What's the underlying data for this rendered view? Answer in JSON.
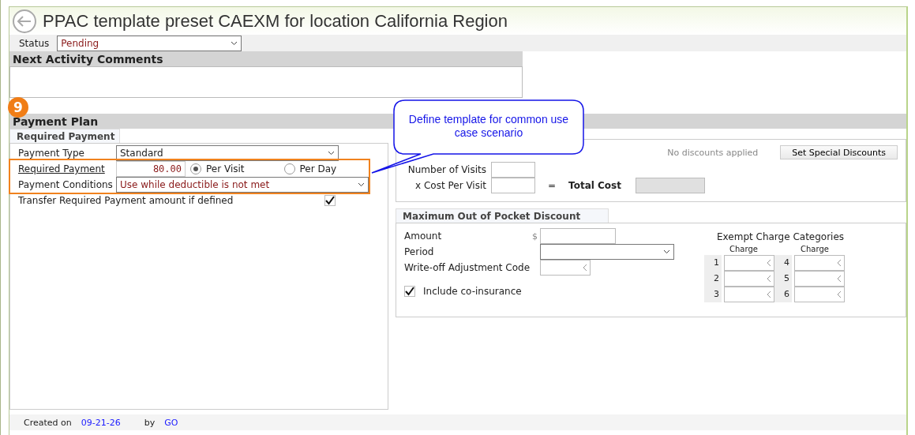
{
  "window": {
    "title": "PPAC template preset CAEXM for location California Region"
  },
  "status": {
    "label": "Status",
    "value": "Pending"
  },
  "comments": {
    "title": "Next Activity Comments"
  },
  "step_badge": "9",
  "callout": "Define template for common use case scenario",
  "payment_plan": {
    "title": "Payment Plan",
    "tab": "Required Payment",
    "payment_type": {
      "label": "Payment Type",
      "value": "Standard"
    },
    "required_payment": {
      "label": "Required Payment",
      "value": "80.00",
      "options": [
        {
          "label": "Per Visit",
          "selected": true
        },
        {
          "label": "Per Day",
          "selected": false
        }
      ]
    },
    "payment_conditions": {
      "label": "Payment Conditions",
      "value": "Use while deductible is not met"
    },
    "transfer": {
      "label": "Transfer Required Payment amount if defined",
      "checked": true
    }
  },
  "discounts": {
    "status": "No discounts applied",
    "button": "Set Special Discounts",
    "visits_label": "Number of Visits",
    "cost_label": "x Cost Per Visit",
    "equals": "=",
    "total_label": "Total Cost"
  },
  "max_oop": {
    "title": "Maximum Out of Pocket Discount",
    "amount_label": "Amount",
    "currency": "$",
    "period_label": "Period",
    "writeoff_label": "Write-off Adjustment Code",
    "coinsurance": {
      "label": "Include co-insurance",
      "checked": true
    },
    "exempt_title": "Exempt Charge Categories",
    "column_headers": [
      "Charge",
      "Charge"
    ],
    "rows": [
      [
        "1",
        "4"
      ],
      [
        "2",
        "5"
      ],
      [
        "3",
        "6"
      ]
    ]
  },
  "footer": {
    "created_label": "Created on",
    "date": "09-21-26",
    "by_label": "by",
    "user": "GO"
  }
}
